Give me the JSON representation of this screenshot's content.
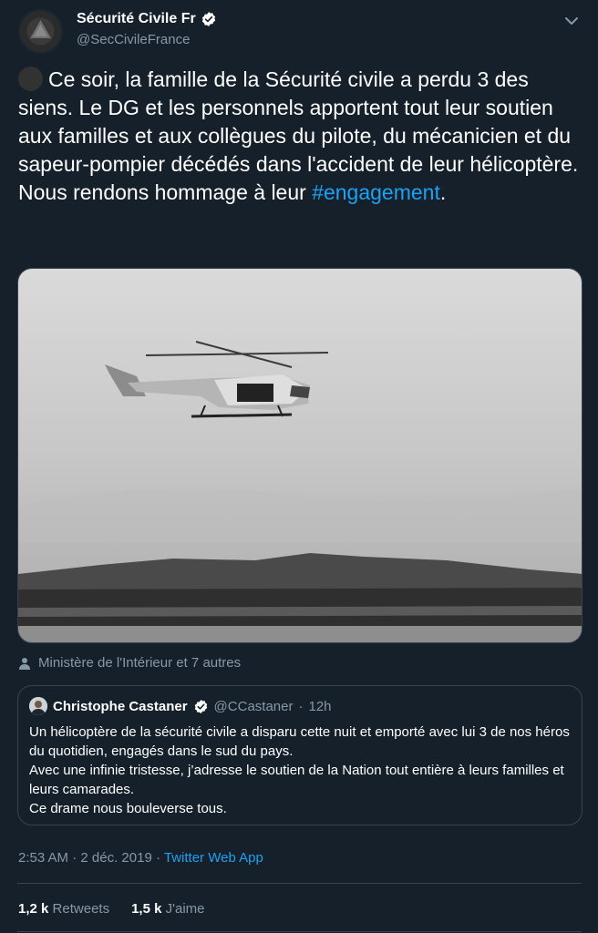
{
  "author": {
    "display_name": "Sécurité Civile Fr",
    "handle": "@SecCivileFrance",
    "verified_icon": "verified-badge-icon"
  },
  "tweet": {
    "text_main": "Ce soir, la famille de la Sécurité civile a perdu 3 des siens. Le DG et les personnels apportent tout leur soutien aux familles et aux collègues du pilote, du mécanicien et du sapeur-pompier décédés dans l'accident de leur hélicoptère.\nNous rendons hommage à leur ",
    "hashtag": "#engagement",
    "text_end": "."
  },
  "tagged": {
    "label": "Ministère de l'Intérieur et 7 autres"
  },
  "quote": {
    "name": "Christophe Castaner",
    "handle": "@CCastaner",
    "sep": "·",
    "time": "12h",
    "text": "Un hélicoptère de la sécurité civile a disparu cette nuit et emporté avec lui 3 de nos héros du quotidien, engagés dans le sud du pays.\nAvec une infinie tristesse, j’adresse le soutien de la Nation tout entière à leurs familles et leurs camarades.\nCe drame nous bouleverse tous."
  },
  "meta": {
    "time": "2:53 AM",
    "sep1": "·",
    "date": "2 déc. 2019",
    "sep2": "·",
    "app": "Twitter Web App"
  },
  "stats": {
    "retweets_count": "1,2 k",
    "retweets_label": "Retweets",
    "likes_count": "1,5 k",
    "likes_label": "J'aime"
  },
  "colors": {
    "background": "#15202b",
    "link": "#1da1f2",
    "secondary_text": "#8899a6",
    "border": "#38444d"
  }
}
